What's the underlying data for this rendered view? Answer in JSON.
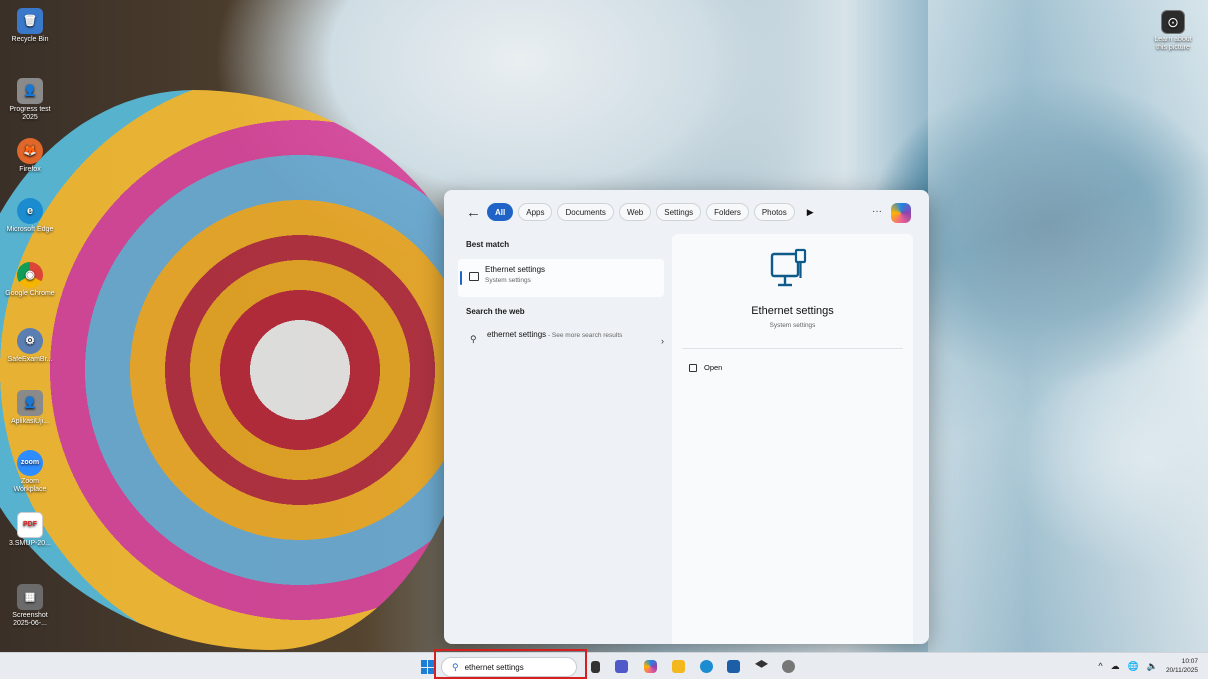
{
  "desktop": {
    "icons": [
      {
        "label": "Recycle Bin",
        "glyph": "🗑"
      },
      {
        "label": "Progress test 2025",
        "glyph": "👤"
      },
      {
        "label": "Firefox",
        "glyph": "🦊"
      },
      {
        "label": "Microsoft Edge",
        "glyph": "e"
      },
      {
        "label": "Google Chrome",
        "glyph": "◉"
      },
      {
        "label": "SafeExamBr...",
        "glyph": "⚙"
      },
      {
        "label": "AplikasiUji...",
        "glyph": "👤"
      },
      {
        "label": "Zoom Workplace",
        "glyph": "zoom"
      },
      {
        "label": "3.SMUP-20...",
        "glyph": "PDF"
      },
      {
        "label": "Screenshot 2025-06-...",
        "glyph": "▦"
      }
    ],
    "top_right_icon": {
      "label": "Learn about this picture",
      "glyph": "⊙"
    }
  },
  "search_panel": {
    "filters": [
      "All",
      "Apps",
      "Documents",
      "Web",
      "Settings",
      "Folders",
      "Photos"
    ],
    "active_filter": "All",
    "more_label": "···",
    "best_match_heading": "Best match",
    "best_match": {
      "title": "Ethernet settings",
      "subtitle": "System settings"
    },
    "web_heading": "Search the web",
    "web_result": {
      "query": "ethernet settings",
      "suffix": " - See more search results"
    },
    "preview": {
      "title": "Ethernet settings",
      "subtitle": "System settings",
      "action": "Open"
    }
  },
  "taskbar": {
    "search_value": "ethernet settings",
    "tray_icons": [
      "^",
      "☁",
      "🌐",
      "🔈"
    ],
    "time": "10:07",
    "date": "20/11/2025"
  }
}
